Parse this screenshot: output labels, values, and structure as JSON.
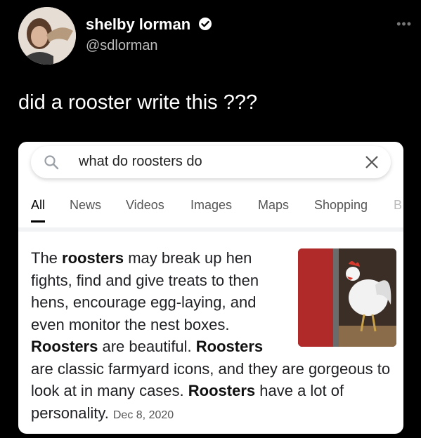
{
  "tweet": {
    "display_name": "shelby lorman",
    "handle": "@sdlorman",
    "more_icon": "ellipsis-icon",
    "text": "did a rooster write this ???"
  },
  "search": {
    "query": "what do roosters do",
    "tabs": [
      {
        "label": "All",
        "active": true
      },
      {
        "label": "News"
      },
      {
        "label": "Videos"
      },
      {
        "label": "Images"
      },
      {
        "label": "Maps"
      },
      {
        "label": "Shopping"
      },
      {
        "label": "B"
      }
    ]
  },
  "snippet": {
    "p1": "The ",
    "p2": "roosters",
    "p3": " may break up hen fights, find and give treats to then hens, encourage egg-laying, and even monitor the nest boxes. ",
    "p4": "Roosters",
    "p5": " are beautiful. ",
    "p6": "Roosters",
    "p7": " are classic farmyard icons, and they are gorgeous to look at in many cases. ",
    "p8": "Roosters",
    "p9": " have a lot of personality.",
    "date": "Dec 8, 2020"
  }
}
